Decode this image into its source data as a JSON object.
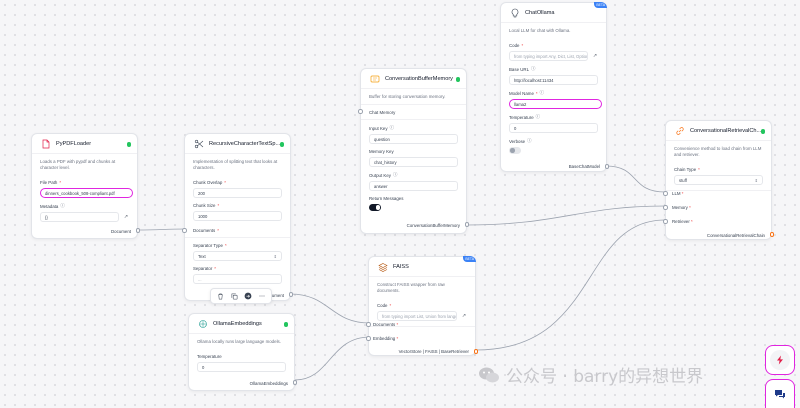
{
  "nodes": {
    "pdf_loader": {
      "title": "PyPDFLoader",
      "description": "Loads a PDF with pypdf and chunks at character level.",
      "file_path_label": "File Path",
      "file_path_value": "dinners_cookbook_508-compliant.pdf",
      "metadata_label": "Metadata",
      "metadata_value": "{}",
      "output_label": "Document"
    },
    "text_splitter": {
      "title": "RecursiveCharacterTextSp...",
      "description": "Implementation of splitting text that looks at characters.",
      "chunk_overlap_label": "Chunk Overlap",
      "chunk_overlap_value": "200",
      "chunk_size_label": "Chunk Size",
      "chunk_size_value": "1000",
      "documents_label": "Documents",
      "separator_type_label": "Separator Type",
      "separator_type_value": "Text",
      "separator_label": "Separator",
      "separator_value": "...",
      "output_label": "Document"
    },
    "memory": {
      "title": "ConversationBufferMemory",
      "description": "Buffer for storing conversation memory.",
      "chat_memory_label": "Chat Memory",
      "input_key_label": "Input Key",
      "input_key_value": "question",
      "memory_key_label": "Memory Key",
      "memory_key_value": "chat_history",
      "output_key_label": "Output Key",
      "output_key_value": "answer",
      "return_messages_label": "Return Messages",
      "output_label": "ConversationBufferMemory"
    },
    "chat_ollama": {
      "title": "ChatOllama",
      "badge": "BETA",
      "description": "Local LLM for chat with Ollama.",
      "code_label": "Code",
      "code_placeholder": "from typing import Any, Dict, List, Optiona...",
      "base_url_label": "Base URL",
      "base_url_value": "http://localhost:11434",
      "model_name_label": "Model Name",
      "model_name_value": "llama2",
      "temperature_label": "Temperature",
      "temperature_value": "0",
      "verbose_label": "Verbose",
      "output_label": "BaseChatModel"
    },
    "retrieval_chain": {
      "title": "ConversationalRetrievalCh...",
      "description": "Convenience method to load chain from LLM and retriever.",
      "chain_type_label": "Chain Type",
      "chain_type_value": "stuff",
      "llm_label": "LLM",
      "memory_label": "Memory",
      "retriever_label": "Retriever",
      "output_label": "ConversationalRetrievalChain"
    },
    "faiss": {
      "title": "FAISS",
      "badge": "BETA",
      "description": "Construct FAISS wrapper from raw documents.",
      "code_label": "Code",
      "code_placeholder": "from typing import List, Union from langc...",
      "documents_label": "Documents",
      "embedding_label": "Embedding",
      "output_label": "VectorStore | FAISS | BaseRetriever"
    },
    "ollama_embeddings": {
      "title": "OllamaEmbeddings",
      "description": "Ollama locally runs large language models.",
      "temperature_label": "Temperature",
      "temperature_value": "0",
      "output_label": "OllamaEmbeddings"
    }
  },
  "toolbar": {
    "icons": [
      "trash-icon",
      "copy-icon",
      "share-icon",
      "more-icon"
    ]
  },
  "watermark": {
    "text": "公众号 · barry的异想世界"
  },
  "colors": {
    "accent": "#e026e0",
    "status_ok": "#22c55e",
    "edge": "#9ca3af"
  }
}
